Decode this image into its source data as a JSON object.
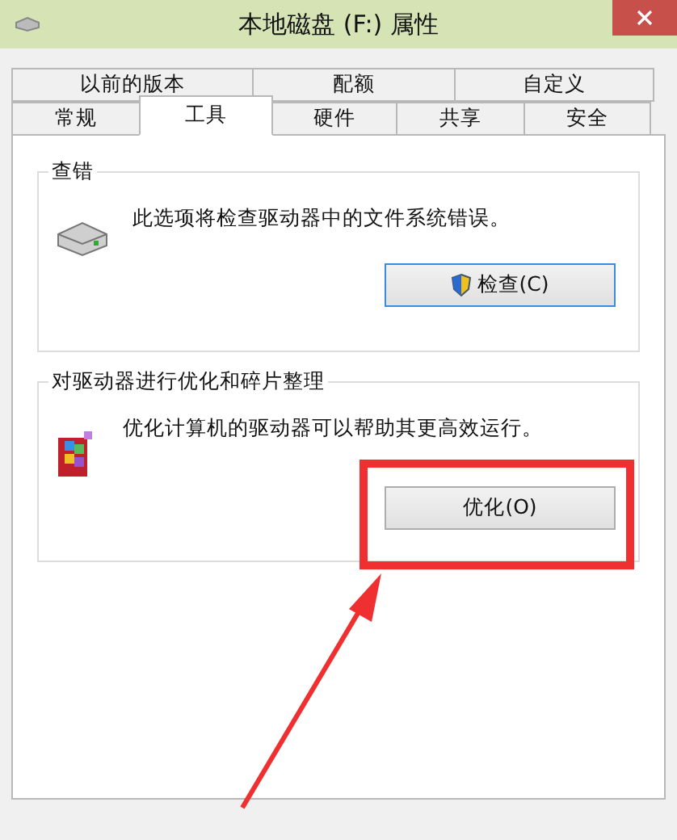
{
  "window": {
    "title": "本地磁盘 (F:) 属性"
  },
  "tab_rows": [
    [
      {
        "label": "以前的版本",
        "selected": false
      },
      {
        "label": "配额",
        "selected": false
      },
      {
        "label": "自定义",
        "selected": false
      }
    ],
    [
      {
        "label": "常规",
        "selected": false
      },
      {
        "label": "工具",
        "selected": true
      },
      {
        "label": "硬件",
        "selected": false
      },
      {
        "label": "共享",
        "selected": false
      },
      {
        "label": "安全",
        "selected": false
      }
    ]
  ],
  "groups": [
    {
      "kind": "check",
      "title": "查错",
      "description": "此选项将检查驱动器中的文件系统错误。",
      "button": "检查(C)"
    },
    {
      "kind": "optimize",
      "title": "对驱动器进行优化和碎片整理",
      "description": "优化计算机的驱动器可以帮助其更高效运行。",
      "button": "优化(O)"
    }
  ]
}
